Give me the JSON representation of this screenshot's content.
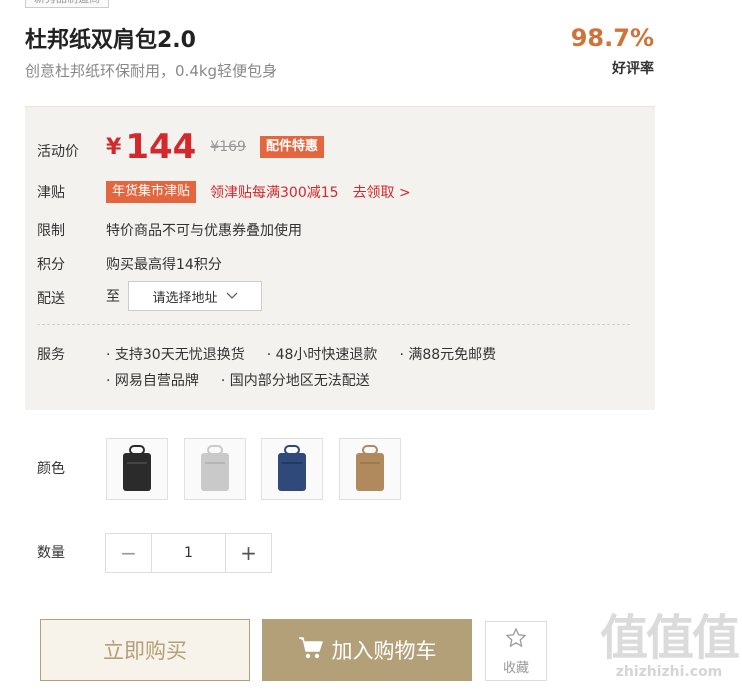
{
  "product": {
    "tag": "新秀品制造商",
    "title": "杜邦纸双肩包2.0",
    "subtitle": "创意杜邦纸环保耐用，0.4kg轻便包身",
    "rating_value": "98.7%",
    "rating_label": "好评率"
  },
  "price": {
    "label": "活动价",
    "symbol": "¥",
    "value": "144",
    "original": "¥169",
    "badge": "配件特惠"
  },
  "subsidy": {
    "label": "津贴",
    "badge": "年货集市津贴",
    "desc": "领津贴每满300减15",
    "action": "去领取 >"
  },
  "limit": {
    "label": "限制",
    "text": "特价商品不可与优惠券叠加使用"
  },
  "points": {
    "label": "积分",
    "text": "购买最高得14积分"
  },
  "delivery": {
    "label": "配送",
    "prefix": "至",
    "placeholder": "请选择地址",
    "chevron_icon": "chevron-down-icon"
  },
  "service": {
    "label": "服务",
    "line1": [
      "· 支持30天无忧退换货",
      "· 48小时快速退款",
      "· 满88元免邮费"
    ],
    "line2": [
      "· 网易自营品牌",
      "· 国内部分地区无法配送"
    ]
  },
  "color": {
    "label": "颜色",
    "options": [
      {
        "name": "黑色",
        "hex": "#2b2b2b"
      },
      {
        "name": "灰色",
        "hex": "#c9c9c9"
      },
      {
        "name": "蓝色",
        "hex": "#2f4a7a"
      },
      {
        "name": "卡其",
        "hex": "#b08a5c"
      }
    ]
  },
  "quantity": {
    "label": "数量",
    "minus": "−",
    "value": "1",
    "plus": "+"
  },
  "actions": {
    "buy_now": "立即购买",
    "add_cart": "加入购物车",
    "favorite": "收藏"
  },
  "watermark": {
    "mark": "值值值",
    "url": "zhizhizhi.com"
  }
}
